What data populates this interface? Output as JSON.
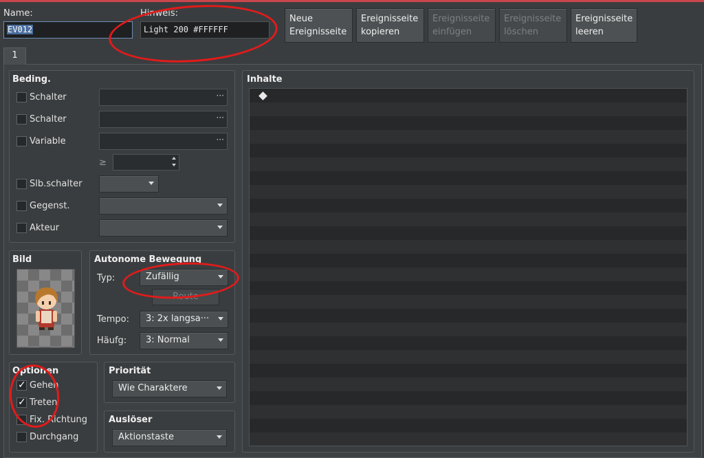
{
  "header": {
    "name_label": "Name:",
    "name_value": "EV012",
    "note_label": "Hinweis:",
    "note_value": "Light 200 #FFFFFF"
  },
  "toolbar": {
    "new_page": [
      "Neue",
      "Ereignisseite"
    ],
    "copy_page": [
      "Ereignisseite",
      "kopieren"
    ],
    "paste_page": [
      "Ereignisseite",
      "einfügen"
    ],
    "delete_page": [
      "Ereignisseite",
      "löschen"
    ],
    "clear_page": [
      "Ereignisseite",
      "leeren"
    ]
  },
  "tab": {
    "label": "1"
  },
  "conditions": {
    "title": "Beding.",
    "rows": [
      {
        "label": "Schalter",
        "dots": "···"
      },
      {
        "label": "Schalter",
        "dots": "···"
      },
      {
        "label": "Variable",
        "dots": "···"
      }
    ],
    "ge_symbol": "≥",
    "self_switch": "Slb.schalter",
    "item": "Gegenst.",
    "actor": "Akteur"
  },
  "image": {
    "title": "Bild"
  },
  "movement": {
    "title": "Autonome Bewegung",
    "type_label": "Typ:",
    "type_value": "Zufällig",
    "route_button": "Route",
    "speed_label": "Tempo:",
    "speed_value": "3: 2x langsa···",
    "freq_label": "Häufg:",
    "freq_value": "3: Normal"
  },
  "options": {
    "title": "Optionen",
    "items": [
      {
        "label": "Gehen",
        "checked": "✓"
      },
      {
        "label": "Treten",
        "checked": "✓"
      },
      {
        "label": "Fix. Richtung",
        "checked": ""
      },
      {
        "label": "Durchgang",
        "checked": ""
      }
    ]
  },
  "priority": {
    "title": "Priorität",
    "value": "Wie Charaktere"
  },
  "trigger": {
    "title": "Auslöser",
    "value": "Aktionstaste"
  },
  "contents": {
    "title": "Inhalte"
  },
  "colors": {
    "accent_line": "#c9464c",
    "annotation": "#e21b1b"
  }
}
